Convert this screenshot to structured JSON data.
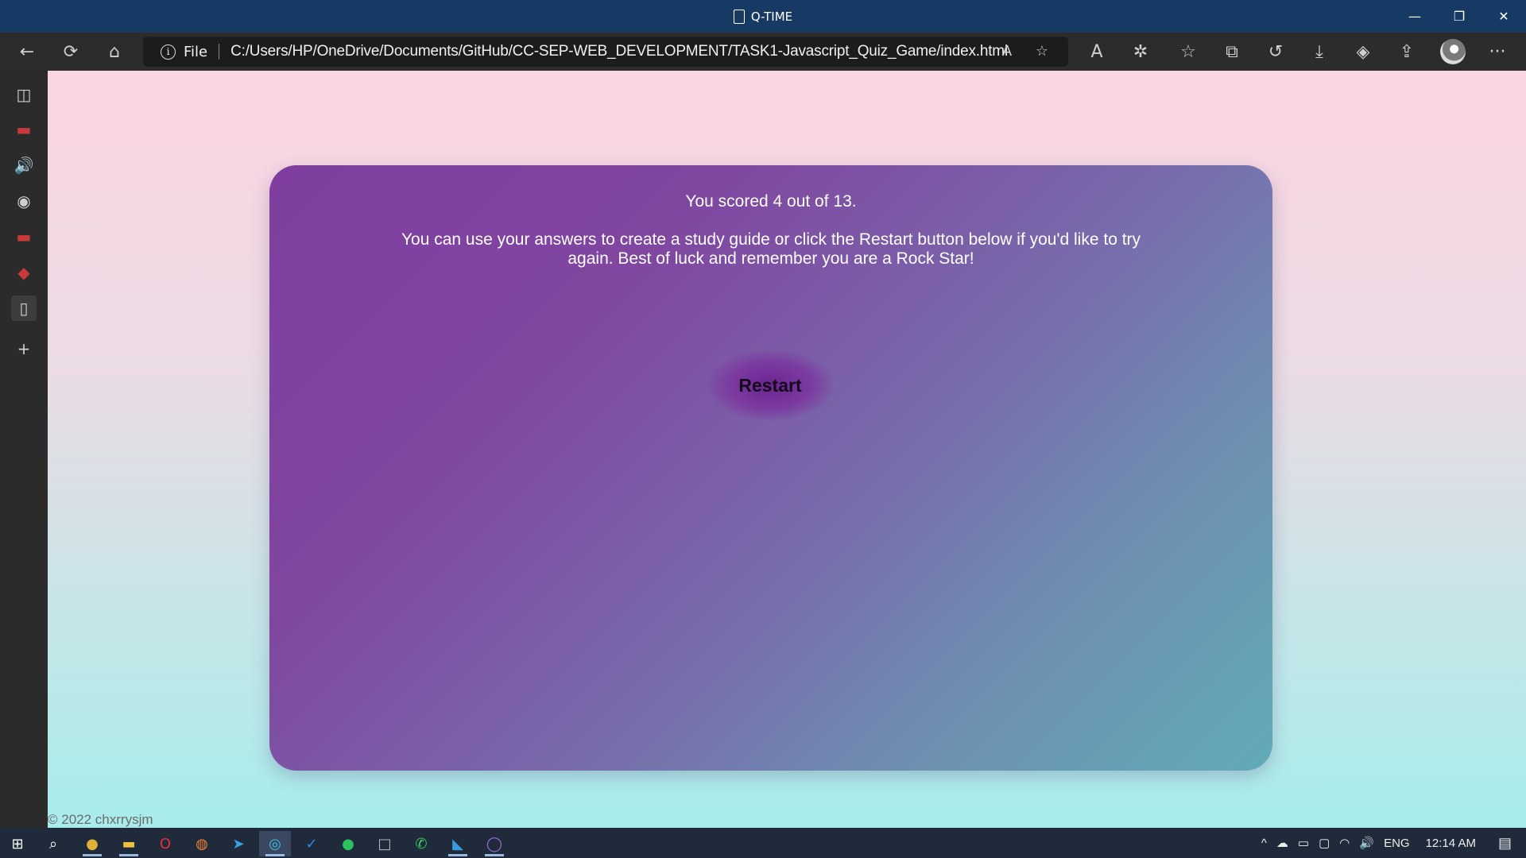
{
  "window": {
    "title": "Q-TIME",
    "minimize": "—",
    "restore": "❐",
    "close": "✕"
  },
  "toolbar": {
    "back": "←",
    "refresh": "⟳",
    "home": "⌂",
    "info": "i",
    "file_label": "File",
    "url": "C:/Users/HP/OneDrive/Documents/GitHub/CC-SEP-WEB_DEVELOPMENT/TASK1-Javascript_Quiz_Game/index.html",
    "read_aloud": "A",
    "add_favorite": "☆",
    "right_icons": [
      "A",
      "✲",
      "☆",
      "⧉",
      "↺",
      "⤓",
      "◈",
      "⇪"
    ],
    "more": "···"
  },
  "sidebar": {
    "icons": [
      "◫",
      "▬",
      "🔊",
      "◉",
      "▬",
      "◆",
      "▯",
      "+"
    ]
  },
  "quiz": {
    "score_text": "You scored 4 out of 13.",
    "message": "You can use your answers to create a study guide or click the Restart button below if you'd like to try again. Best of luck and remember you are a Rock Star!",
    "restart_label": "Restart",
    "footer": "© 2022 chxrrysjm"
  },
  "taskbar": {
    "start": "⊞",
    "search": "⌕",
    "apps": [
      "●",
      "▬",
      "O",
      "◍",
      "➤",
      "◎",
      "✓",
      "●",
      "□",
      "✆",
      "◣",
      "◯"
    ],
    "tray": {
      "chevron": "^",
      "language": "ENG",
      "time": "12:14 AM",
      "notifications": "▤"
    }
  }
}
